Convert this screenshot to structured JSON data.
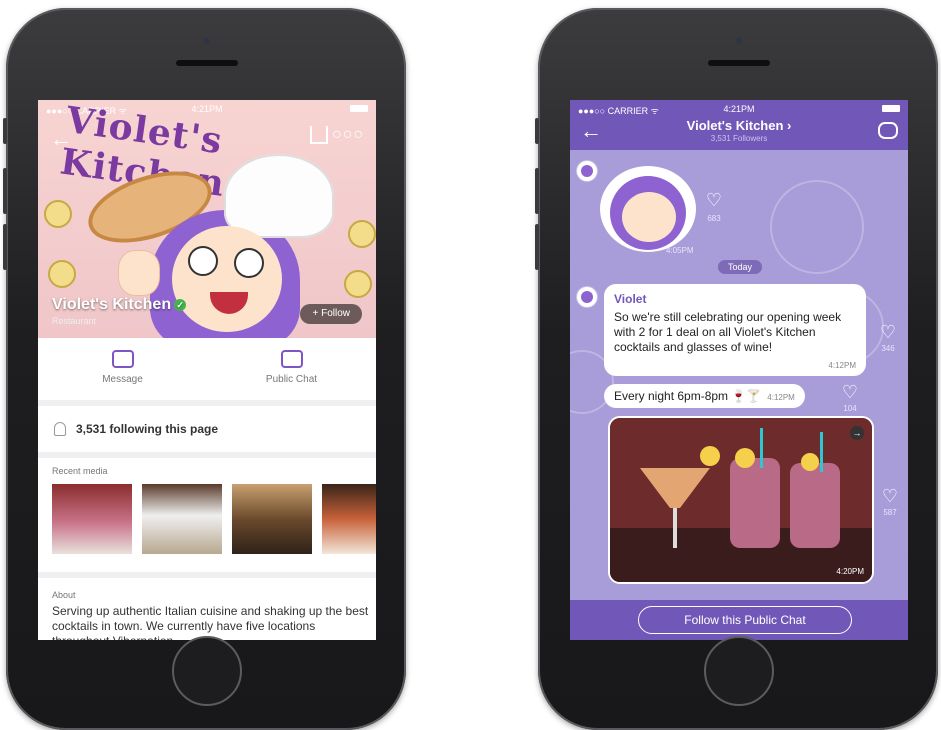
{
  "left_phone": {
    "status": {
      "carrier": "●●●○○ CARRIER ᯤ",
      "time": "4:21PM"
    },
    "cover": {
      "title_art": "Violet's Kitchen"
    },
    "page": {
      "name": "Violet's Kitchen",
      "verified_glyph": "✓",
      "category": "Restaurant",
      "follow_label": "+ Follow"
    },
    "actions": [
      {
        "label": "Message",
        "icon": "message-icon"
      },
      {
        "label": "Public Chat",
        "icon": "public-chat-icon"
      }
    ],
    "following_text": "3,531 following this page",
    "recent_media_title": "Recent media",
    "about": {
      "title": "About",
      "text": "Serving up authentic Italian cuisine and shaking up the best cocktails in town. We currently have five locations throughout Vibernation."
    }
  },
  "right_phone": {
    "status": {
      "carrier": "●●●○○ CARRIER ᯤ",
      "time": "4:21PM"
    },
    "header": {
      "title": "Violet's Kitchen ›",
      "followers": "3,531 Followers"
    },
    "sticker_likes": "683",
    "sticker_time": "4:05PM",
    "date_divider": "Today",
    "message1": {
      "sender": "Violet",
      "text": "So we're still celebrating our opening week with 2 for 1 deal on all Violet's Kitchen cocktails and glasses of wine!",
      "time": "4:12PM",
      "likes": "346"
    },
    "message2": {
      "text": "Every night 6pm-8pm 🍷🍸",
      "time": "4:12PM",
      "likes": "104"
    },
    "photo_message": {
      "time": "4:20PM",
      "likes": "587"
    },
    "footer": {
      "follow_label": "Follow this Public Chat"
    }
  },
  "colors": {
    "viber_purple": "#7157b8",
    "chat_background": "#a89cd9",
    "verified_green": "#42b549"
  }
}
